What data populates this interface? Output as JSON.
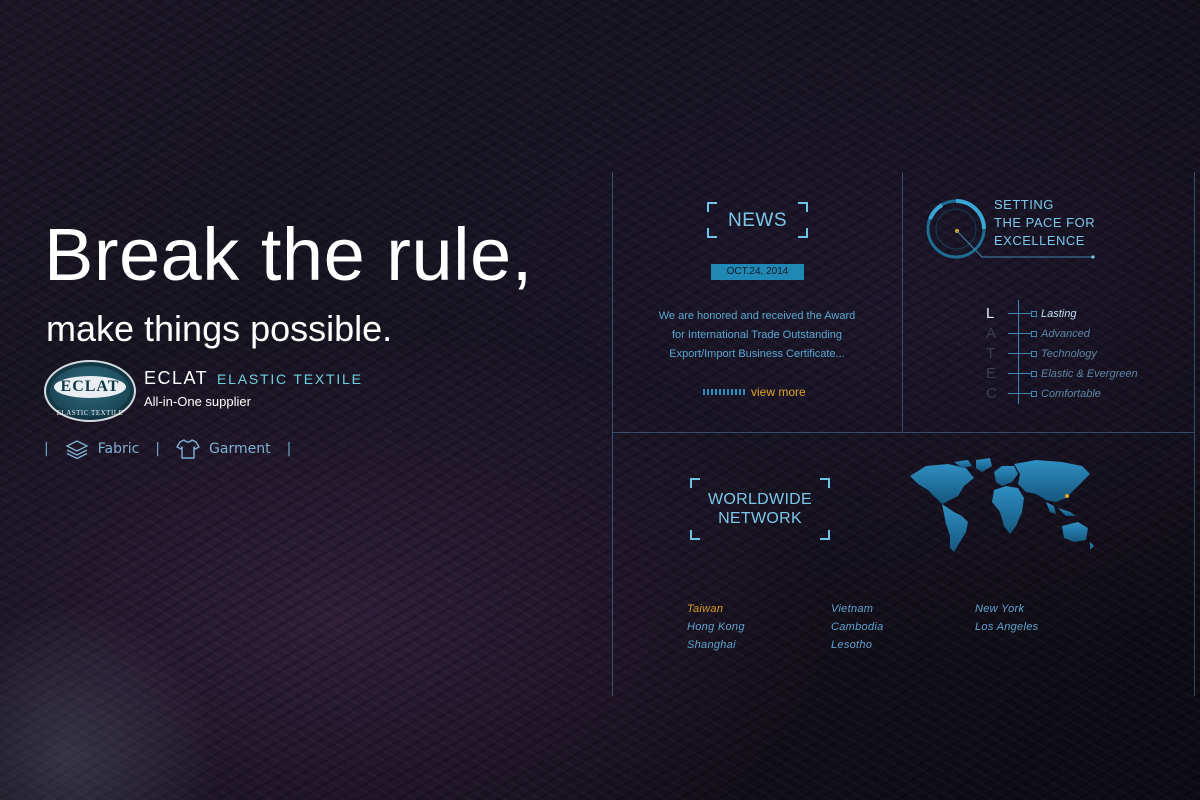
{
  "hero": {
    "title": "Break the rule,",
    "subtitle": "make things possible."
  },
  "brand": {
    "logo_text": "ECLAT",
    "logo_ring_text": "ELASTIC TEXTILE",
    "name": "ECLAT",
    "tagline": "ELASTIC TEXTILE",
    "description": "All-in-One supplier"
  },
  "nav": {
    "items": [
      {
        "label": "Fabric",
        "icon": "layers-icon"
      },
      {
        "label": "Garment",
        "icon": "shirt-icon"
      }
    ]
  },
  "news": {
    "title": "NEWS",
    "date": "OCT.24, 2014",
    "body_lines": [
      "We are honored and received the Award",
      "for International Trade Outstanding",
      "Export/Import Business Certificate..."
    ],
    "view_more": "view more"
  },
  "setting": {
    "lines": [
      "SETTING",
      "THE PACE FOR",
      "EXCELLENCE"
    ],
    "values": [
      {
        "letter": "L",
        "label": "Lasting"
      },
      {
        "letter": "A",
        "label": "Advanced"
      },
      {
        "letter": "T",
        "label": "Technology"
      },
      {
        "letter": "E",
        "label": "Elastic & Evergreen"
      },
      {
        "letter": "C",
        "label": "Comfortable"
      }
    ]
  },
  "worldwide": {
    "title_lines": [
      "WORLDWIDE",
      "NETWORK"
    ],
    "cities": [
      [
        "Taiwan",
        "Hong Kong",
        "Shanghai"
      ],
      [
        "Vietnam",
        "Cambodia",
        "Lesotho"
      ],
      [
        "New York",
        "Los Angeles"
      ]
    ]
  },
  "colors": {
    "accent_blue": "#7cc8ea",
    "highlight_orange": "#e0a526",
    "date_bg": "#1f88b4"
  }
}
